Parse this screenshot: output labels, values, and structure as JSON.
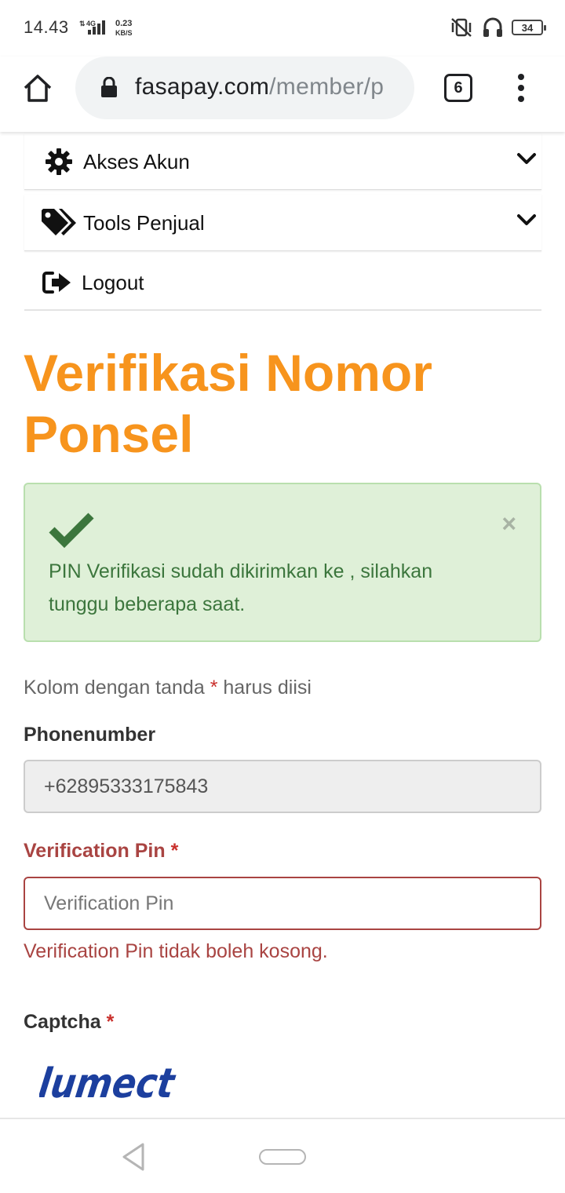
{
  "status_bar": {
    "time": "14.43",
    "network_type": "4G",
    "speed_value": "0.23",
    "speed_unit": "KB/S",
    "battery": "34",
    "icons": [
      "vibrate-icon",
      "headphones-icon",
      "battery-icon",
      "signal-icon"
    ]
  },
  "browser": {
    "url_domain": "fasapay.com",
    "url_path": "/member/p",
    "tab_count": "6",
    "icons": [
      "home-icon",
      "lock-icon",
      "more-menu-icon"
    ]
  },
  "nav": {
    "items": [
      {
        "label": "Akses Akun",
        "icon": "gear-icon",
        "expandable": true
      },
      {
        "label": "Tools Penjual",
        "icon": "tags-icon",
        "expandable": true
      },
      {
        "label": "Logout",
        "icon": "sign-out-icon",
        "expandable": false
      }
    ]
  },
  "page": {
    "title_line1": "Verifikasi Nomor",
    "title_line2": "Ponsel"
  },
  "alert": {
    "type": "success",
    "message_line1": "PIN Verifikasi sudah dikirimkan ke , silahkan",
    "message_line2": "tunggu beberapa saat.",
    "close_symbol": "×"
  },
  "form": {
    "required_note_before": "Kolom dengan tanda",
    "required_star": "*",
    "required_note_after": "harus diisi",
    "phone_label": "Phonenumber",
    "phone_value": "+62895333175843",
    "pin_label": "Verification Pin",
    "pin_placeholder": "Verification Pin",
    "pin_value": "",
    "pin_error": "Verification Pin tidak boleh kosong.",
    "captcha_label": "Captcha",
    "captcha_text": "lumect"
  },
  "colors": {
    "title": "#f7941d",
    "success_bg": "#dff0d8",
    "success_text": "#3c763d",
    "error": "#a94442",
    "required": "#c9302c"
  }
}
